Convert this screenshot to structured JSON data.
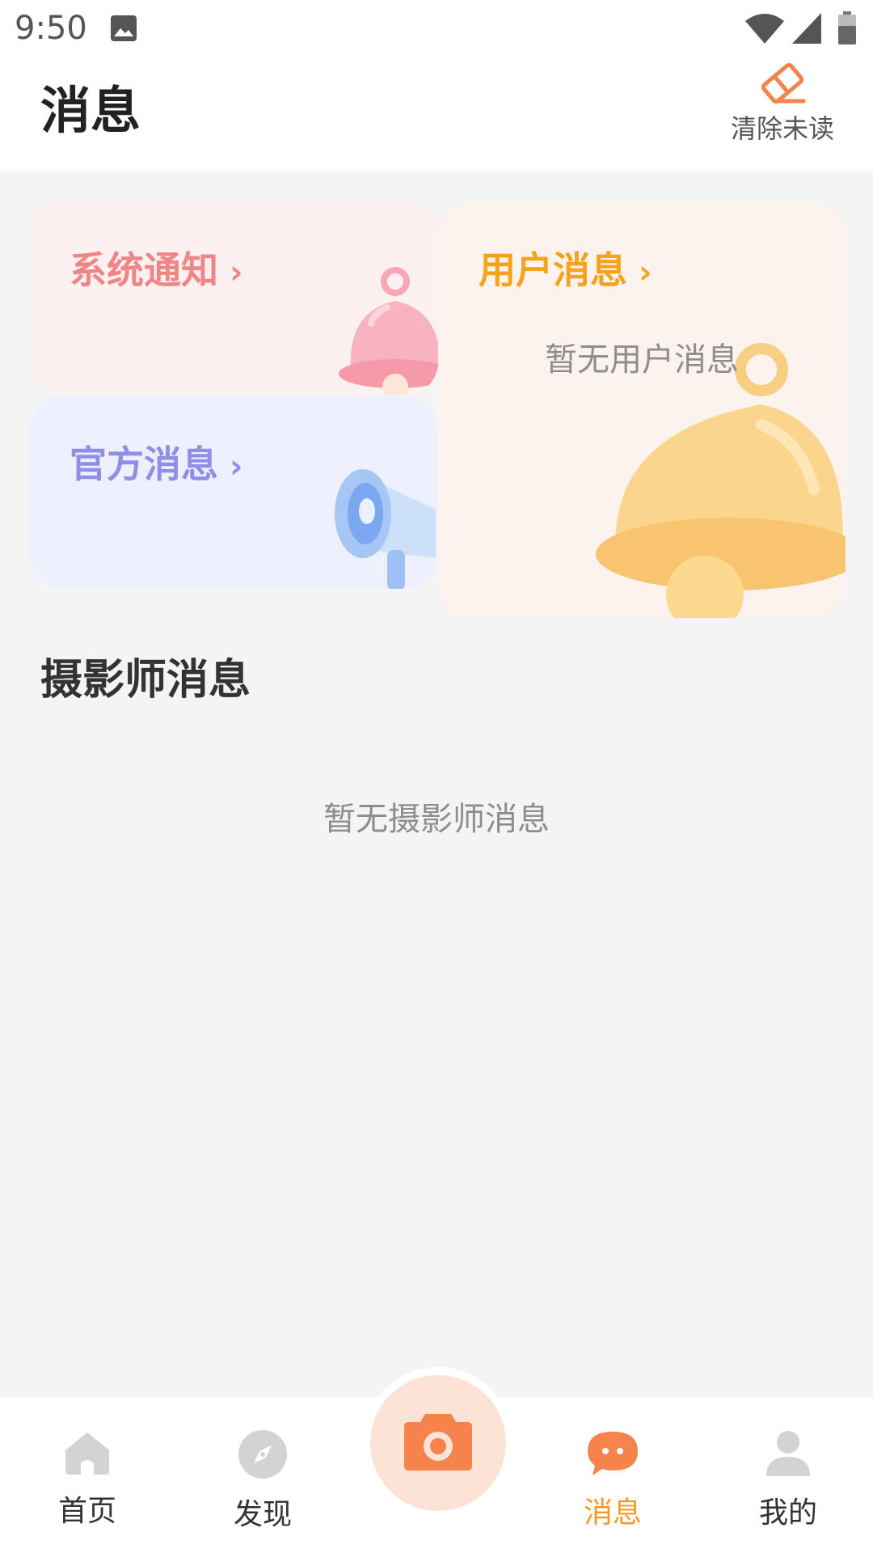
{
  "status_bar": {
    "time": "9:50"
  },
  "header": {
    "title": "消息",
    "clear_unread_label": "清除未读"
  },
  "cards": {
    "system": {
      "title": "系统通知",
      "chevron": "›"
    },
    "official": {
      "title": "官方消息",
      "chevron": "›"
    },
    "user": {
      "title": "用户消息",
      "chevron": "›",
      "empty_text": "暂无用户消息"
    }
  },
  "photographer_section": {
    "title": "摄影师消息",
    "empty_text": "暂无摄影师消息"
  },
  "tabbar": {
    "tabs": [
      {
        "label": "首页",
        "icon": "home-icon",
        "active": false
      },
      {
        "label": "发现",
        "icon": "compass-icon",
        "active": false
      },
      {
        "label": "消息",
        "icon": "chat-bubble-icon",
        "active": true
      },
      {
        "label": "我的",
        "icon": "person-icon",
        "active": false
      }
    ],
    "center_action_icon": "camera-icon"
  },
  "colors": {
    "accent": "#f39a25",
    "system_card": "#fdf0f0",
    "official_card": "#eef0fd",
    "user_card": "#fdf3ee",
    "camera_icon": "#f5834b"
  }
}
